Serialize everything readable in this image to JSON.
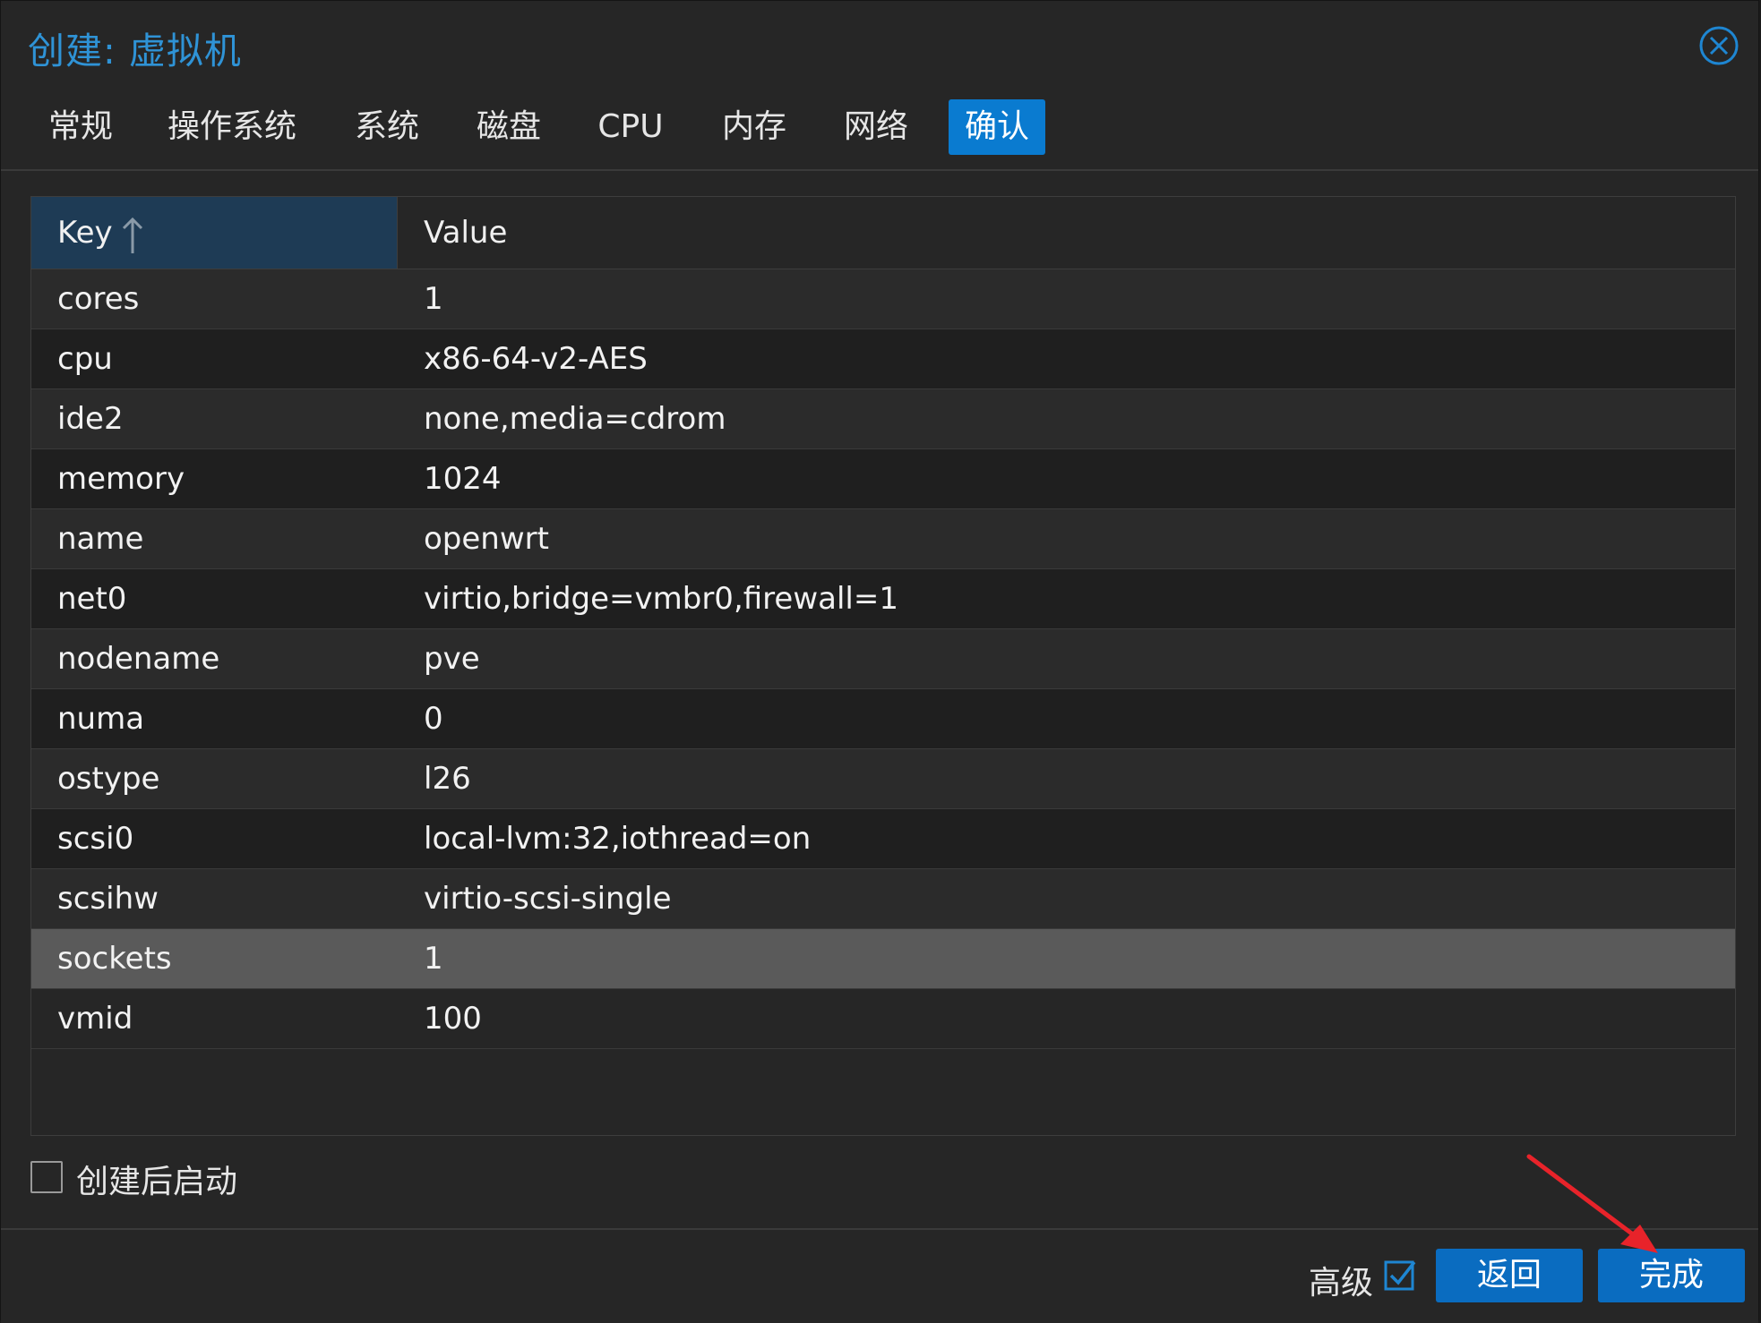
{
  "title": "创建: 虚拟机",
  "tabs": [
    {
      "label": "常规"
    },
    {
      "label": "操作系统"
    },
    {
      "label": "系统"
    },
    {
      "label": "磁盘"
    },
    {
      "label": "CPU"
    },
    {
      "label": "内存"
    },
    {
      "label": "网络"
    },
    {
      "label": "确认"
    }
  ],
  "active_tab": "确认",
  "grid": {
    "headers": {
      "key": "Key",
      "value": "Value"
    },
    "sort": "Key ascending",
    "rows": [
      {
        "key": "cores",
        "value": "1"
      },
      {
        "key": "cpu",
        "value": "x86-64-v2-AES"
      },
      {
        "key": "ide2",
        "value": "none,media=cdrom"
      },
      {
        "key": "memory",
        "value": "1024"
      },
      {
        "key": "name",
        "value": "openwrt"
      },
      {
        "key": "net0",
        "value": "virtio,bridge=vmbr0,firewall=1"
      },
      {
        "key": "nodename",
        "value": "pve"
      },
      {
        "key": "numa",
        "value": "0"
      },
      {
        "key": "ostype",
        "value": "l26"
      },
      {
        "key": "scsi0",
        "value": "local-lvm:32,iothread=on"
      },
      {
        "key": "scsihw",
        "value": "virtio-scsi-single"
      },
      {
        "key": "sockets",
        "value": "1"
      },
      {
        "key": "vmid",
        "value": "100"
      }
    ],
    "selected_row": "sockets"
  },
  "start_after_create": {
    "label": "创建后启动",
    "checked": false
  },
  "footer": {
    "advanced_label": "高级",
    "advanced_checked": true,
    "back_label": "返回",
    "finish_label": "完成"
  },
  "colors": {
    "accent": "#0a7bd0",
    "title": "#2f93d6",
    "annotation_arrow": "#e8232a"
  }
}
